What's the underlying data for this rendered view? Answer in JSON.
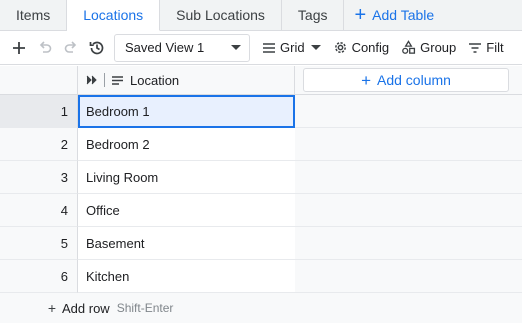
{
  "tabs": [
    {
      "label": "Items",
      "active": false
    },
    {
      "label": "Locations",
      "active": true
    },
    {
      "label": "Sub Locations",
      "active": false
    },
    {
      "label": "Tags",
      "active": false
    }
  ],
  "add_table_label": "Add Table",
  "toolbar": {
    "view_name": "Saved View 1",
    "grid_label": "Grid",
    "config_label": "Config",
    "group_label": "Group",
    "filter_label": "Filt"
  },
  "grid": {
    "column_header": "Location",
    "add_column_label": "Add column",
    "rows": [
      {
        "num": "1",
        "value": "Bedroom 1"
      },
      {
        "num": "2",
        "value": "Bedroom 2"
      },
      {
        "num": "3",
        "value": "Living Room"
      },
      {
        "num": "4",
        "value": "Office"
      },
      {
        "num": "5",
        "value": "Basement"
      },
      {
        "num": "6",
        "value": "Kitchen"
      }
    ],
    "add_row_label": "Add row",
    "add_row_hint": "Shift-Enter"
  },
  "colors": {
    "accent": "#1a73e8",
    "selected_cell_bg": "#e8f0fe"
  }
}
